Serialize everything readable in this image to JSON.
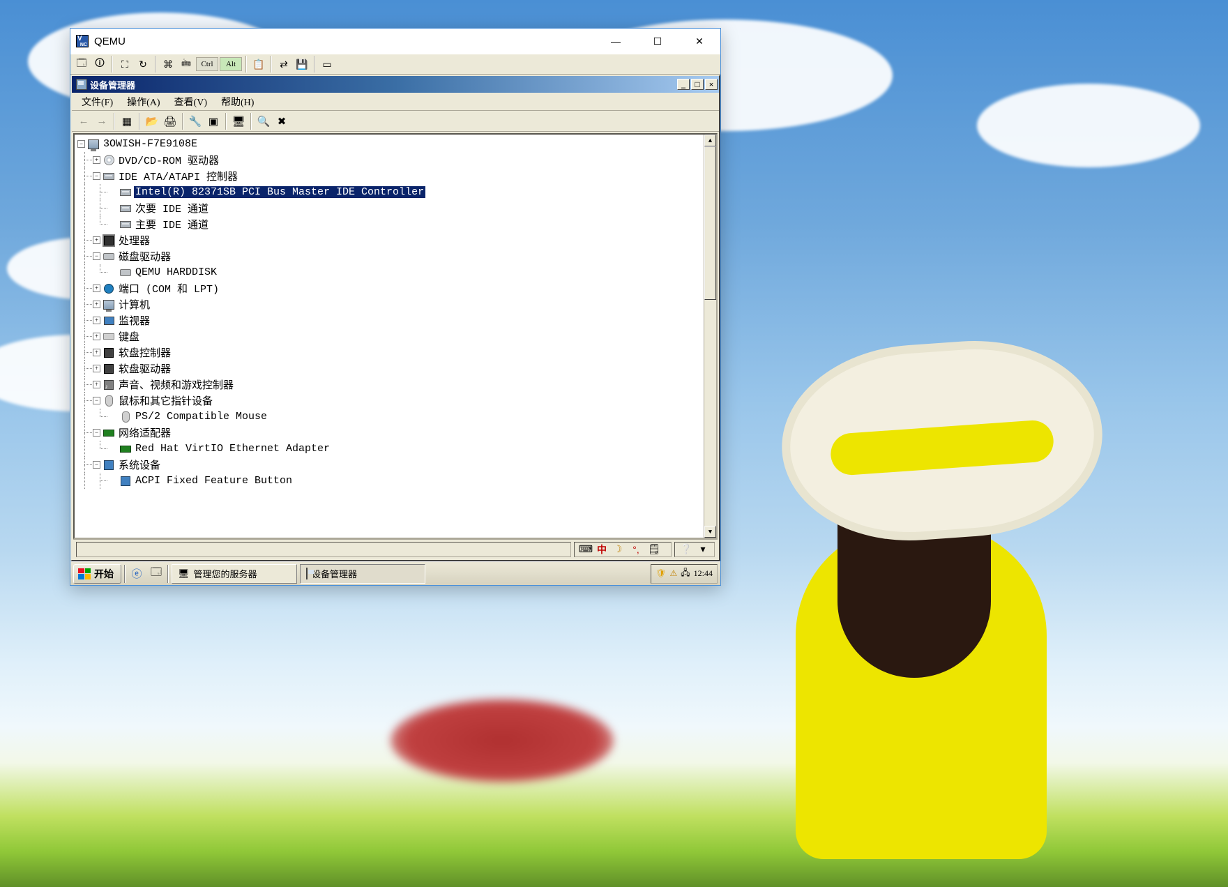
{
  "vnc": {
    "title": "QEMU",
    "ctrl_key": "Ctrl",
    "alt_key": "Alt"
  },
  "dm": {
    "title": "设备管理器",
    "menu": {
      "file": "文件(F)",
      "action": "操作(A)",
      "view": "查看(V)",
      "help": "帮助(H)"
    },
    "tree": {
      "root": "3OWISH-F7E9108E",
      "dvd": "DVD/CD-ROM 驱动器",
      "ide": "IDE ATA/ATAPI 控制器",
      "ide_sel": "Intel(R) 82371SB PCI Bus Master IDE Controller",
      "ide_sec": "次要 IDE 通道",
      "ide_pri": "主要 IDE 通道",
      "cpu": "处理器",
      "diskdrv": "磁盘驱动器",
      "qemu_hd": "QEMU HARDDISK",
      "ports": "端口 (COM 和 LPT)",
      "computer": "计算机",
      "monitor": "监视器",
      "keyboard": "键盘",
      "fdc": "软盘控制器",
      "fdd": "软盘驱动器",
      "sound": "声音、视频和游戏控制器",
      "mouse": "鼠标和其它指针设备",
      "ps2mouse": "PS/2 Compatible Mouse",
      "net": "网络适配器",
      "virtio": "Red Hat VirtIO Ethernet Adapter",
      "sys": "系统设备",
      "acpi": "ACPI Fixed Feature Button"
    },
    "ime_zhong": "中"
  },
  "taskbar": {
    "start": "开始",
    "task1": "管理您的服务器",
    "task2": "设备管理器",
    "clock": "12:44"
  }
}
